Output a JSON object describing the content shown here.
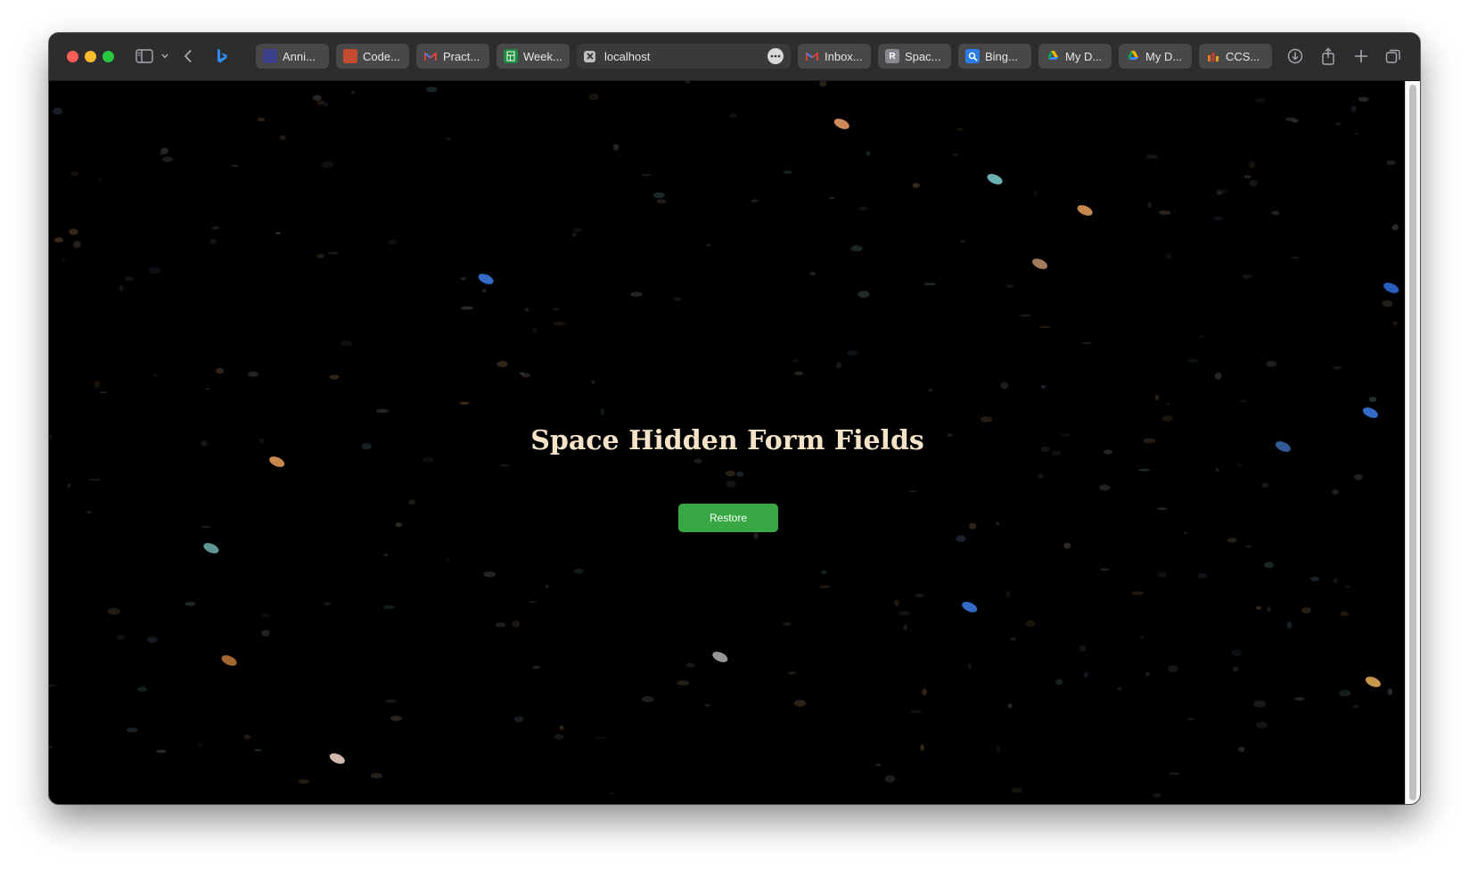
{
  "browser": {
    "tabs": [
      {
        "label": "Anni...",
        "icon": "annie-page-icon",
        "color": "#3b3f8a"
      },
      {
        "label": "Code...",
        "icon": "code-page-icon",
        "color": "#c44b2f"
      },
      {
        "label": "Pract...",
        "icon": "gmail-icon",
        "color": "#ffffff"
      },
      {
        "label": "Week...",
        "icon": "sheets-icon",
        "color": "#1e8e3e"
      },
      {
        "label": "localhost",
        "icon": "close-tab-icon",
        "color": "#5a5a5d",
        "active": true
      },
      {
        "label": "Inbox...",
        "icon": "gmail-icon",
        "color": "#ffffff"
      },
      {
        "label": "Spac...",
        "icon": "letter-r-icon",
        "color": "#8a8a8e",
        "letter": "R"
      },
      {
        "label": "Bing...",
        "icon": "bing-search-icon",
        "color": "#2b7de9"
      },
      {
        "label": "My D...",
        "icon": "google-drive-icon",
        "color": "#f4b400"
      },
      {
        "label": "My D...",
        "icon": "google-drive-icon",
        "color": "#f4b400"
      },
      {
        "label": "CCS...",
        "icon": "ccs-icon",
        "color": "#e8731d"
      }
    ]
  },
  "page": {
    "title": "Space Hidden Form Fields",
    "restore_label": "Restore"
  },
  "colors": {
    "title": "#f6e3c8",
    "button": "#38a844",
    "background": "#000000"
  }
}
